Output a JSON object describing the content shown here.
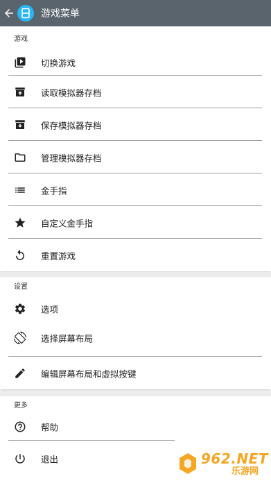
{
  "header": {
    "title": "游戏菜单"
  },
  "sections": [
    {
      "title": "游戏",
      "items": [
        {
          "label": "切换游戏",
          "icon": "play-library-icon"
        },
        {
          "label": "读取模拟器存档",
          "icon": "upload-box-icon"
        },
        {
          "label": "保存模拟器存档",
          "icon": "download-box-icon"
        },
        {
          "label": "管理模拟器存档",
          "icon": "folder-icon"
        },
        {
          "label": "金手指",
          "icon": "list-icon"
        },
        {
          "label": "自定义金手指",
          "icon": "star-icon"
        },
        {
          "label": "重置游戏",
          "icon": "reset-icon"
        }
      ]
    },
    {
      "title": "设置",
      "items": [
        {
          "label": "选项",
          "icon": "gear-icon"
        },
        {
          "label": "选择屏幕布局",
          "icon": "screen-rotation-icon"
        },
        {
          "label": "编辑屏幕布局和虚拟按键",
          "icon": "pencil-icon"
        }
      ]
    },
    {
      "title": "更多",
      "items": [
        {
          "label": "帮助",
          "icon": "help-icon"
        },
        {
          "label": "退出",
          "icon": "power-icon"
        }
      ]
    }
  ],
  "watermark": {
    "text": "962.NET",
    "subtext": "乐游网"
  },
  "colors": {
    "appbar": "#5a646c",
    "logo": "#29b6f6",
    "divider": "#9e9e9e",
    "watermark": "#f5a623"
  }
}
